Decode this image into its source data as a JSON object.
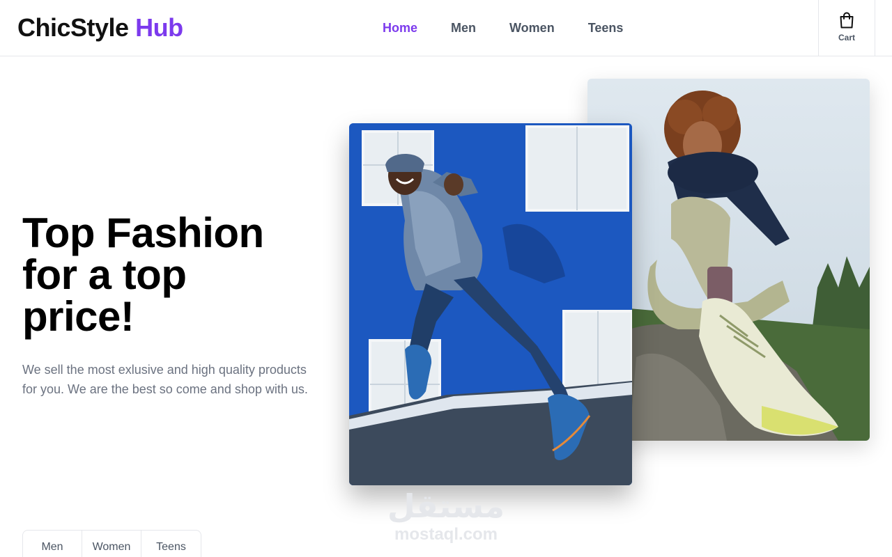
{
  "brand": {
    "name_part1": "ChicStyle",
    "name_part2": "Hub",
    "accent_color": "#7c3aed"
  },
  "nav": {
    "items": [
      {
        "label": "Home",
        "active": true
      },
      {
        "label": "Men",
        "active": false
      },
      {
        "label": "Women",
        "active": false
      },
      {
        "label": "Teens",
        "active": false
      }
    ]
  },
  "cart": {
    "label": "Cart",
    "icon": "shopping-bag-icon"
  },
  "hero": {
    "title_line1": "Top Fashion",
    "title_line2": "for a top",
    "title_line3": "price!",
    "description": "We sell the most exlusive and high quality products for you. We are the best so come and shop with us."
  },
  "images": {
    "front": "running-man-photo",
    "back": "sitting-woman-photo"
  },
  "watermark": {
    "arabic": "مستقل",
    "latin": "mostaql.com"
  },
  "filter_tabs": [
    {
      "label": "Men"
    },
    {
      "label": "Women"
    },
    {
      "label": "Teens"
    }
  ]
}
